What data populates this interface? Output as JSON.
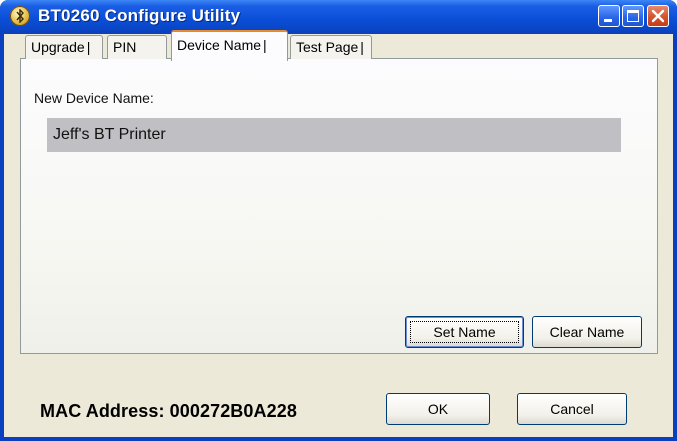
{
  "window": {
    "title": "BT0260 Configure Utility",
    "icon": "bluetooth-app-icon"
  },
  "titlebar_buttons": {
    "minimize": "minimize-icon",
    "maximize": "maximize-icon",
    "close": "close-icon"
  },
  "tabs": [
    {
      "label": "Upgrade",
      "selected": false
    },
    {
      "label": "PIN",
      "selected": false
    },
    {
      "label": "Device Name",
      "selected": true
    },
    {
      "label": "Test Page",
      "selected": false
    }
  ],
  "device_name": {
    "label": "New Device Name:",
    "value": "Jeff's BT Printer",
    "set_button": "Set Name",
    "clear_button": "Clear Name"
  },
  "footer": {
    "mac_address": "MAC Address: 000272B0A228",
    "ok_button": "OK",
    "cancel_button": "Cancel"
  },
  "colors": {
    "titlebar_blue": "#0b4fd8",
    "dialog_bg": "#ece9d8",
    "close_red": "#d4532e",
    "tab_highlight": "#e68b2c",
    "name_field_bg": "#c0bfc4"
  }
}
